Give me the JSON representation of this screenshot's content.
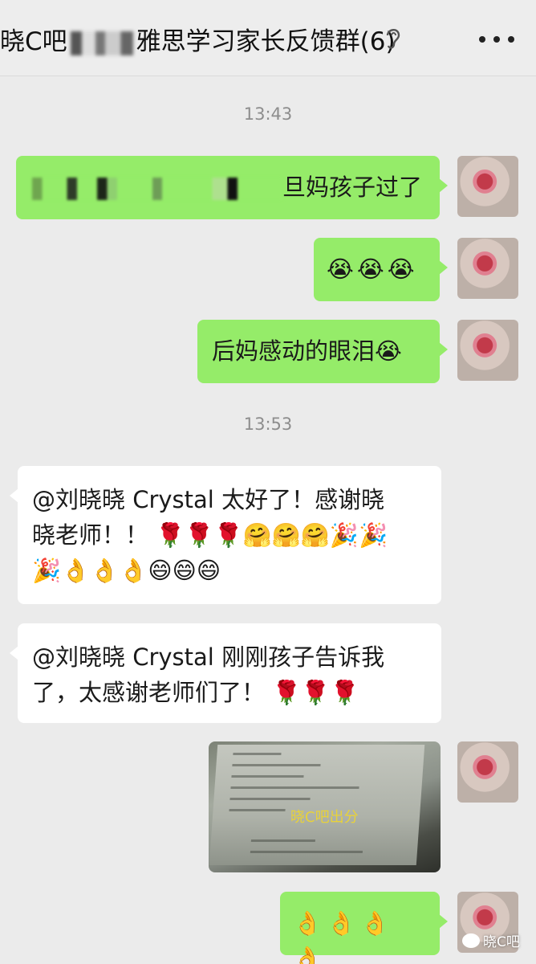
{
  "header": {
    "title_prefix": "晓C吧",
    "title_suffix": "雅思学习家长反馈群(6)"
  },
  "timestamps": [
    "13:43",
    "13:53"
  ],
  "messages": {
    "m1_text": "旦妈孩子过了",
    "m2_emojis": "😭😭😭",
    "m3_text": "后妈感动的眼泪",
    "m3_emoji": "😭",
    "m4_mention": "@刘晓晓 Crystal",
    "m4_line1_rest": "太好了！感谢晓",
    "m4_line2": "晓老师！！",
    "m4_line2_emojis": "🌹🌹🌹🤗🤗🤗🎉🎉",
    "m4_line3_emojis": "🎉👌👌👌😄😄😄",
    "m5_mention": "@刘晓晓 Crystal",
    "m5_line1_rest": "刚刚孩子告诉我",
    "m5_line2": "了，太感谢老师们了！",
    "m5_line2_emojis": "🌹🌹🌹",
    "m6_photo_watermark": "晓C吧出分",
    "m7_emojis": "👌👌👌👌"
  },
  "watermark": {
    "label": "晓C吧"
  },
  "colors": {
    "background": "#ebebeb",
    "sent_bubble": "#95ec69",
    "received_bubble": "#ffffff",
    "timestamp": "#8d8d8d"
  },
  "icons": [
    "ear-icon",
    "more-icon"
  ]
}
